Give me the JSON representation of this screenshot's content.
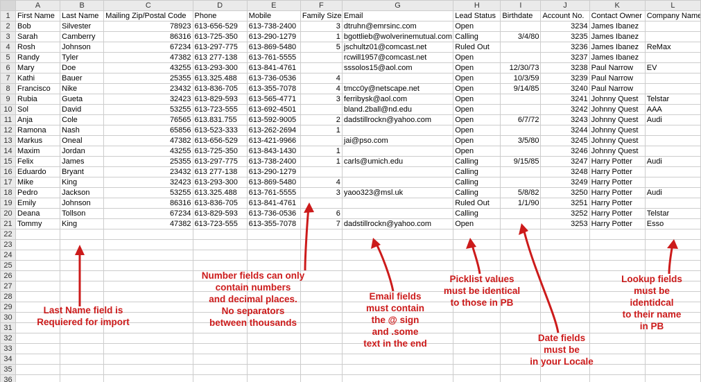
{
  "columns": [
    "A",
    "B",
    "C",
    "D",
    "E",
    "F",
    "G",
    "H",
    "I",
    "J",
    "K",
    "L"
  ],
  "headers": {
    "A": "First Name",
    "B": "Last Name",
    "C": "Mailing Zip/Postal Code",
    "D": "Phone",
    "E": "Mobile",
    "F": "Family Size",
    "G": "Email",
    "H": "Lead Status",
    "I": "Birthdate",
    "J": "Account No.",
    "K": "Contact Owner",
    "L": "Company Name"
  },
  "rows": [
    {
      "A": "Bob",
      "B": "Silvester",
      "C": "78923",
      "D": "613-656-529",
      "E": "613-738-2400",
      "F": "3",
      "G": "dtruhn@emrsinc.com",
      "H": "Open",
      "I": "",
      "J": "3234",
      "K": "James Ibanez",
      "L": ""
    },
    {
      "A": "Sarah",
      "B": "Camberry",
      "C": "86316",
      "D": "613-725-350",
      "E": "613-290-1279",
      "F": "1",
      "G": "bgottlieb@wolverinemutual.com",
      "H": "Calling",
      "I": "3/4/80",
      "J": "3235",
      "K": "James Ibanez",
      "L": ""
    },
    {
      "A": "Rosh",
      "B": "Johnson",
      "C": "67234",
      "D": "613-297-775",
      "E": "613-869-5480",
      "F": "5",
      "G": "jschultz01@comcast.net",
      "H": "Ruled Out",
      "I": "",
      "J": "3236",
      "K": "James Ibanez",
      "L": "ReMax"
    },
    {
      "A": "Randy",
      "B": "Tyler",
      "C": "47382",
      "D": "613 277-138",
      "E": "613-761-5555",
      "F": "",
      "G": "rcwill1957@comcast.net",
      "H": "Open",
      "I": "",
      "J": "3237",
      "K": "James Ibanez",
      "L": ""
    },
    {
      "A": "Mary",
      "B": "Doe",
      "C": "43255",
      "D": "613-293-300",
      "E": "613-841-4761",
      "F": "",
      "G": "sssolos15@aol.com",
      "H": "Open",
      "I": "12/30/73",
      "J": "3238",
      "K": "Paul Narrow",
      "L": "EV"
    },
    {
      "A": "Kathi",
      "B": "Bauer",
      "C": "25355",
      "D": "613.325.488",
      "E": "613-736-0536",
      "F": "4",
      "G": "",
      "H": "Open",
      "I": "10/3/59",
      "J": "3239",
      "K": "Paul Narrow",
      "L": ""
    },
    {
      "A": "Francisco",
      "B": "Nike",
      "C": "23432",
      "D": "613-836-705",
      "E": "613-355-7078",
      "F": "4",
      "G": "tmcc0y@netscape.net",
      "H": "Open",
      "I": "9/14/85",
      "J": "3240",
      "K": "Paul Narrow",
      "L": ""
    },
    {
      "A": "Rubia",
      "B": "Gueta",
      "C": "32423",
      "D": "613-829-593",
      "E": "613-565-4771",
      "F": "3",
      "G": "ferribysk@aol.com",
      "H": "Open",
      "I": "",
      "J": "3241",
      "K": "Johnny Quest",
      "L": "Telstar"
    },
    {
      "A": "Sol",
      "B": "David",
      "C": "53255",
      "D": "613-723-555",
      "E": "613-692-4501",
      "F": "",
      "G": "bland.2ball@nd.edu",
      "H": "Open",
      "I": "",
      "J": "3242",
      "K": "Johnny Quest",
      "L": "AAA"
    },
    {
      "A": "Anja",
      "B": "Cole",
      "C": "76565",
      "D": "613.831.755",
      "E": "613-592-9005",
      "F": "2",
      "G": "dadstillrockn@yahoo.com",
      "H": "Open",
      "I": "6/7/72",
      "J": "3243",
      "K": "Johnny Quest",
      "L": "Audi"
    },
    {
      "A": "Ramona",
      "B": "Nash",
      "C": "65856",
      "D": "613-523-333",
      "E": "613-262-2694",
      "F": "1",
      "G": "",
      "H": "Open",
      "I": "",
      "J": "3244",
      "K": "Johnny Quest",
      "L": ""
    },
    {
      "A": "Markus",
      "B": "Oneal",
      "C": "47382",
      "D": "613-656-529",
      "E": "613-421-9966",
      "F": "",
      "G": "jai@pso.com",
      "H": "Open",
      "I": "3/5/80",
      "J": "3245",
      "K": "Johnny Quest",
      "L": ""
    },
    {
      "A": "Maxim",
      "B": "Jordan",
      "C": "43255",
      "D": "613-725-350",
      "E": "613-843-1430",
      "F": "1",
      "G": "",
      "H": "Open",
      "I": "",
      "J": "3246",
      "K": "Johnny Quest",
      "L": ""
    },
    {
      "A": "Felix",
      "B": "James",
      "C": "25355",
      "D": "613-297-775",
      "E": "613-738-2400",
      "F": "1",
      "G": "carls@umich.edu",
      "H": "Calling",
      "I": "9/15/85",
      "J": "3247",
      "K": "Harry Potter",
      "L": "Audi"
    },
    {
      "A": "Eduardo",
      "B": "Bryant",
      "C": "23432",
      "D": "613 277-138",
      "E": "613-290-1279",
      "F": "",
      "G": "",
      "H": "Calling",
      "I": "",
      "J": "3248",
      "K": "Harry Potter",
      "L": ""
    },
    {
      "A": "Mike",
      "B": "King",
      "C": "32423",
      "D": "613-293-300",
      "E": "613-869-5480",
      "F": "4",
      "G": "",
      "H": "Calling",
      "I": "",
      "J": "3249",
      "K": "Harry Potter",
      "L": ""
    },
    {
      "A": "Pedro",
      "B": "Jackson",
      "C": "53255",
      "D": "613.325.488",
      "E": "613-761-5555",
      "F": "3",
      "G": "yaoo323@msl.uk",
      "H": "Calling",
      "I": "5/8/82",
      "J": "3250",
      "K": "Harry Potter",
      "L": "Audi"
    },
    {
      "A": "Emily",
      "B": "Johnson",
      "C": "86316",
      "D": "613-836-705",
      "E": "613-841-4761",
      "F": "",
      "G": "",
      "H": "Ruled Out",
      "I": "1/1/90",
      "J": "3251",
      "K": "Harry Potter",
      "L": ""
    },
    {
      "A": "Deana",
      "B": "Tollson",
      "C": "67234",
      "D": "613-829-593",
      "E": "613-736-0536",
      "F": "6",
      "G": "",
      "H": "Calling",
      "I": "",
      "J": "3252",
      "K": "Harry Potter",
      "L": "Telstar"
    },
    {
      "A": "Tommy",
      "B": "King",
      "C": "47382",
      "D": "613-723-555",
      "E": "613-355-7078",
      "F": "7",
      "G": "dadstillrockn@yahoo.com",
      "H": "Open",
      "I": "",
      "J": "3253",
      "K": "Harry Potter",
      "L": "Esso"
    }
  ],
  "blank_rows": 15,
  "annotations": {
    "lastname": "Last Name field is\nRequiered for import",
    "numbers": "Number fields can only\ncontain numbers\nand decimal places.\nNo separators\nbetween  thousands",
    "email": "Email fields\nmust contain\nthe @ sign\nand .some\ntext in the end",
    "picklist": "Picklist values\nmust be identical\nto those in PB",
    "dates": "Date fields\nmust be\nin your Locale",
    "lookup": "Lookup fields\nmust be\nidentidcal\nto their name\nin PB"
  }
}
